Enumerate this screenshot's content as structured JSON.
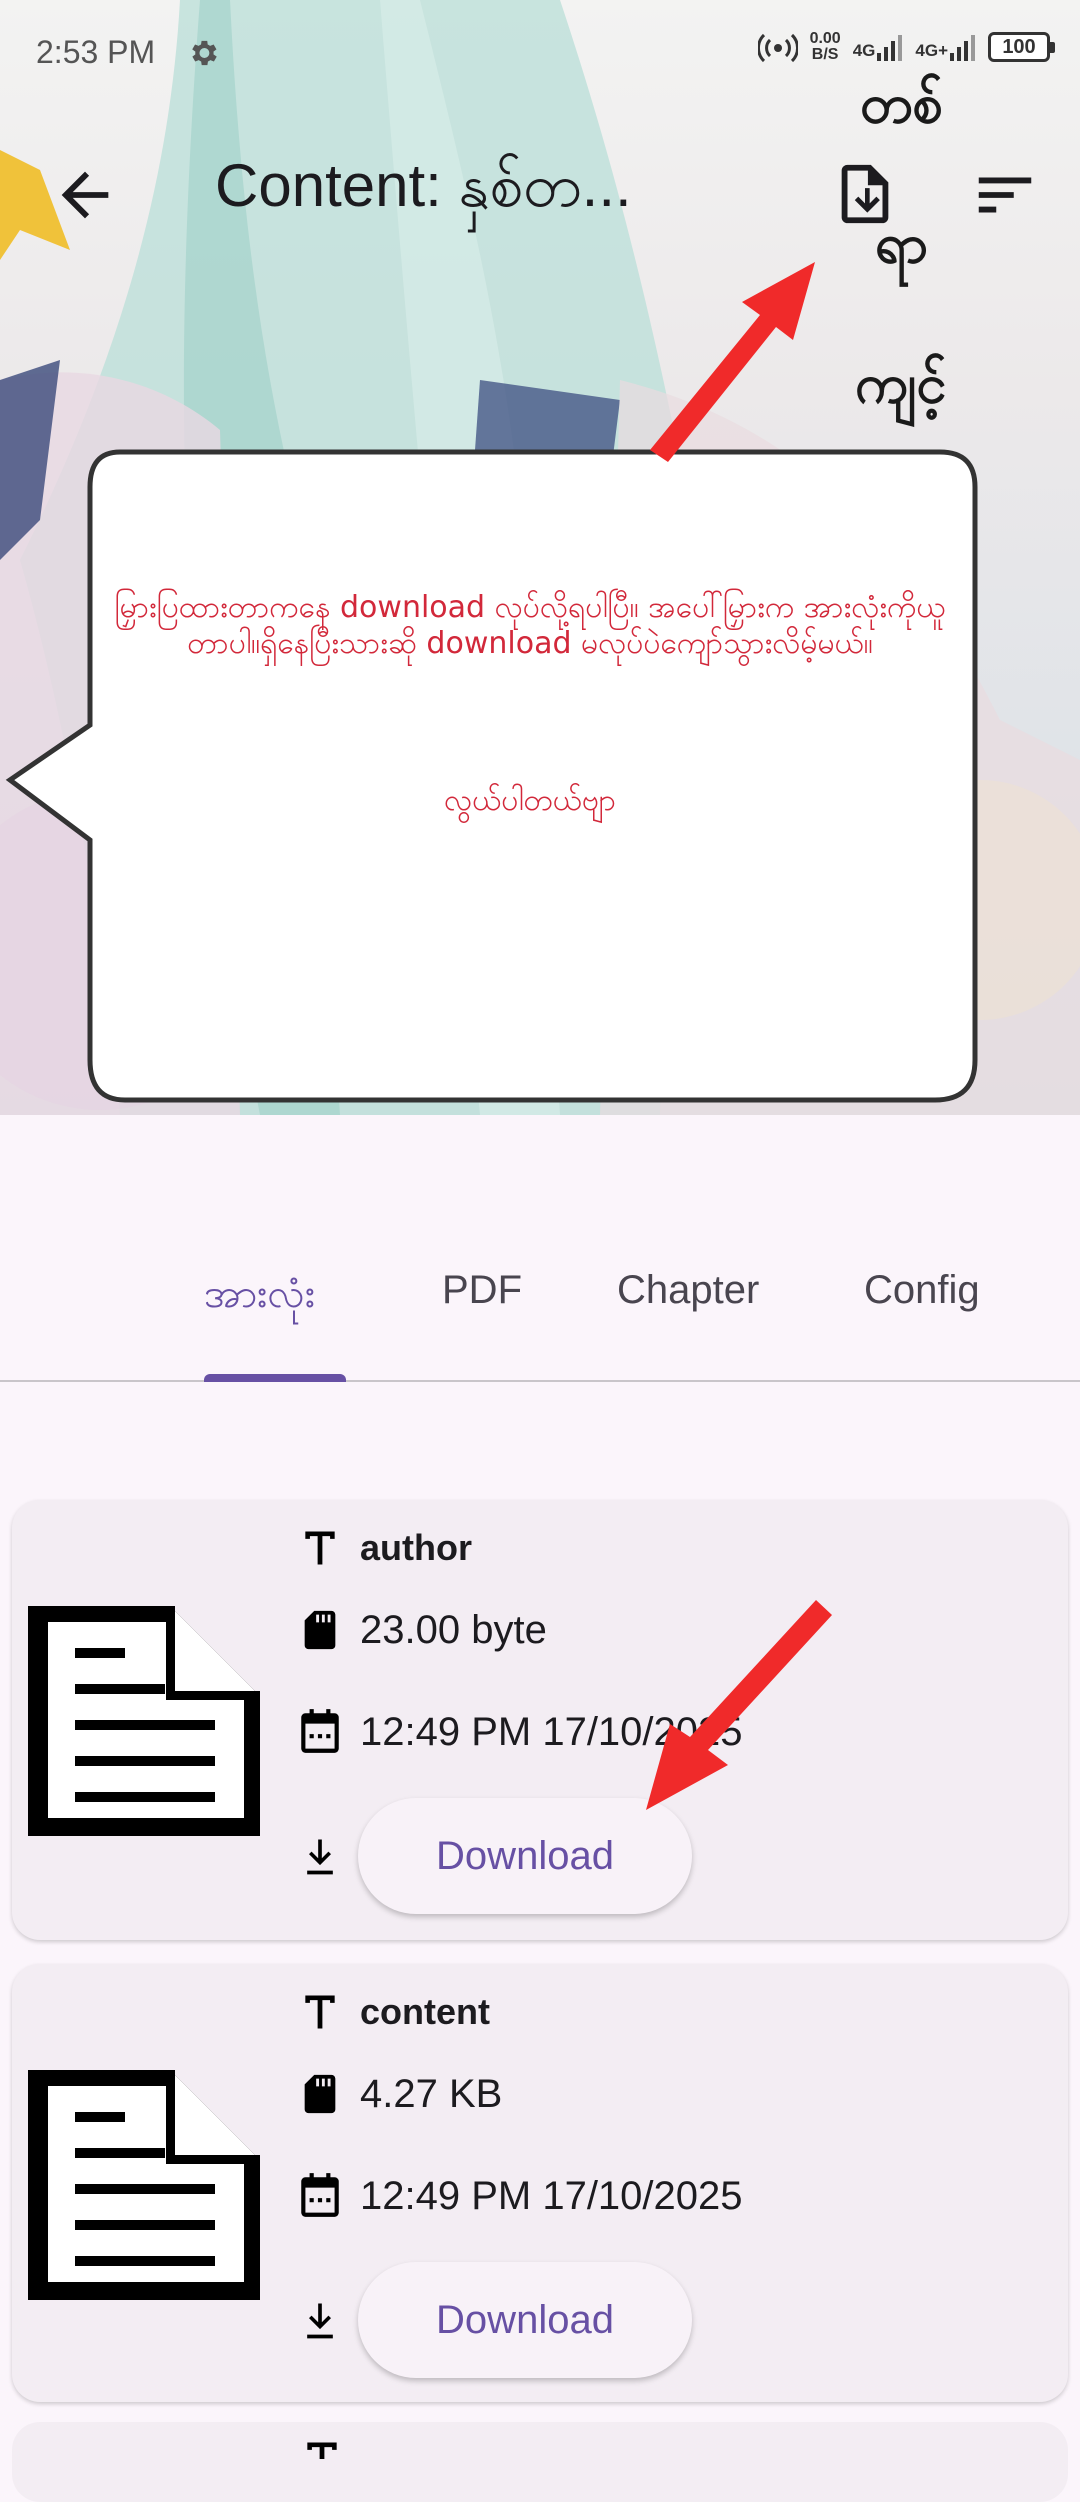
{
  "status_bar": {
    "time": "2:53 PM",
    "net_speed_value": "0.00",
    "net_speed_unit": "B/S",
    "sim1_label": "4G",
    "sim2_label": "4G+",
    "battery": "100"
  },
  "app_bar": {
    "title": "Content: နှစ်တ...",
    "decor_lines": [
      "တစ်",
      "ရာ",
      "ကျင့်"
    ]
  },
  "bubble": {
    "message": "မြှားပြထားတာကနေ download လုပ်လို့ရပါပြီ။ အပေါ်မြှားက အားလုံးကိုယူတာပါ။ရှိနေပြီးသားဆို download မလုပ်ပဲကျော်သွားလိမ့်မယ်။",
    "signature": "လွယ်ပါတယ်ဗျာ"
  },
  "tabs": [
    {
      "label": "အားလုံး",
      "active": true
    },
    {
      "label": "PDF",
      "active": false
    },
    {
      "label": "Chapter",
      "active": false
    },
    {
      "label": "Config",
      "active": false
    }
  ],
  "files": [
    {
      "name": "author",
      "size": "23.00 byte",
      "date": "12:49 PM 17/10/2025",
      "button": "Download"
    },
    {
      "name": "content",
      "size": "4.27 KB",
      "date": "12:49 PM 17/10/2025",
      "button": "Download"
    }
  ],
  "colors": {
    "accent": "#6750a4",
    "bubble_text": "#d2283a",
    "arrow": "#f02a2a"
  }
}
